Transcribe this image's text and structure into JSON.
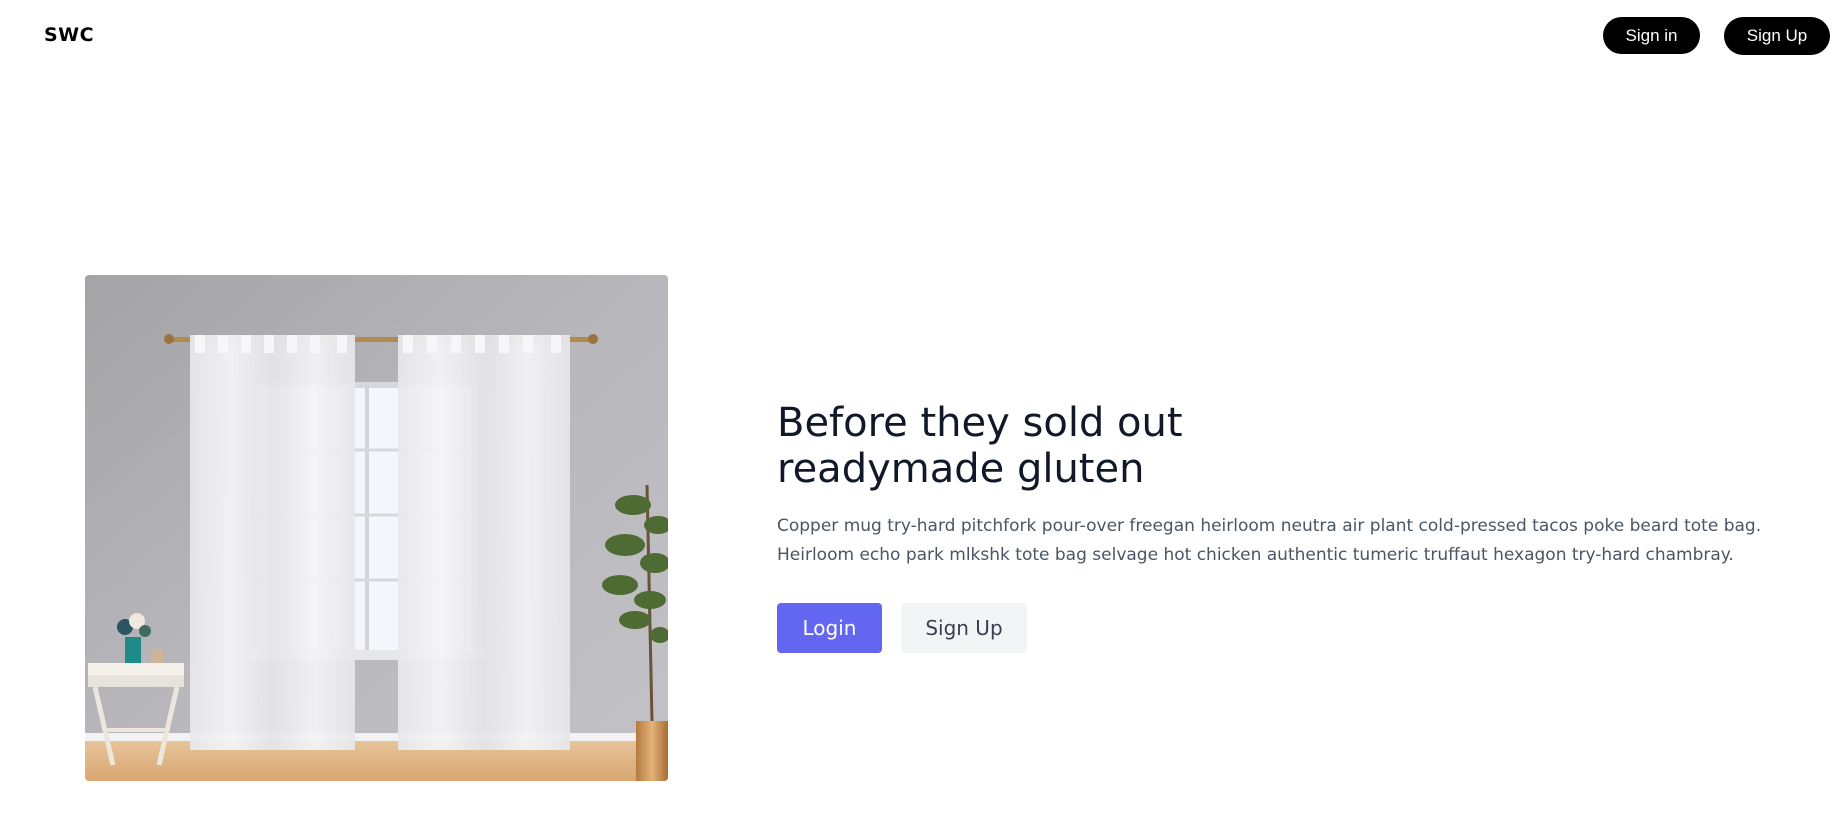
{
  "header": {
    "brand": "SWC",
    "signin_label": "Sign in",
    "signup_label": "Sign Up"
  },
  "hero": {
    "image_alt": "curtains-room-photo",
    "headline_line1": "Before they sold out",
    "headline_line2": "readymade gluten",
    "description_line1": "Copper mug try-hard pitchfork pour-over freegan heirloom neutra air plant cold-pressed tacos poke beard tote bag.",
    "description_line2": "Heirloom echo park mlkshk tote bag selvage hot chicken authentic tumeric truffaut hexagon try-hard chambray.",
    "primary_button": "Login",
    "secondary_button": "Sign Up"
  },
  "colors": {
    "accent": "#6366f1",
    "nav_button_bg": "#000000",
    "secondary_button_bg": "#f3f4f6",
    "text_muted": "#4b5563"
  }
}
